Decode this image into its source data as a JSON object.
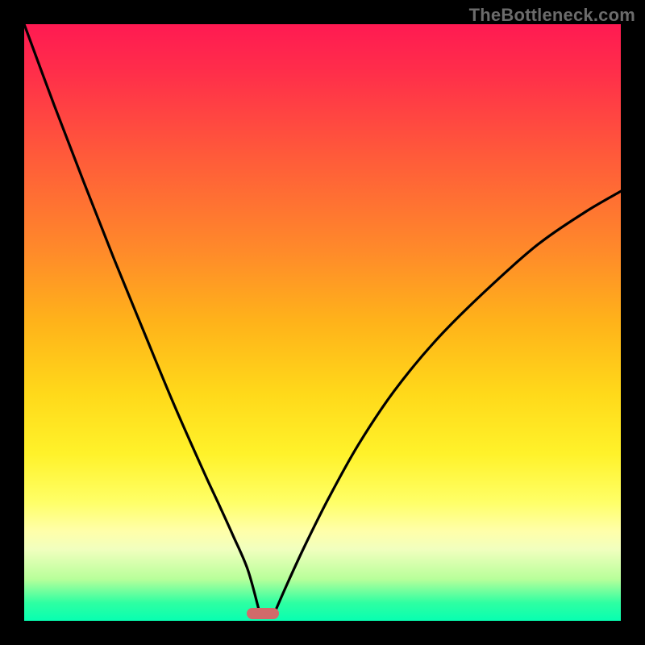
{
  "watermark": "TheBottleneck.com",
  "chart_data": {
    "type": "line",
    "title": "",
    "xlabel": "",
    "ylabel": "",
    "xlim": [
      0,
      1
    ],
    "ylim": [
      0,
      1
    ],
    "background": "rainbow-gradient-red-to-green",
    "marker": {
      "x": 0.4,
      "y": 0.99,
      "shape": "rounded-capsule",
      "color": "#d26a6a"
    },
    "series": [
      {
        "name": "left-curve",
        "x": [
          0.0,
          0.05,
          0.1,
          0.15,
          0.2,
          0.25,
          0.3,
          0.325,
          0.35,
          0.375,
          0.395
        ],
        "y": [
          1.0,
          0.865,
          0.735,
          0.608,
          0.486,
          0.365,
          0.252,
          0.198,
          0.143,
          0.085,
          0.012
        ]
      },
      {
        "name": "right-curve",
        "x": [
          0.419,
          0.44,
          0.47,
          0.51,
          0.56,
          0.62,
          0.69,
          0.77,
          0.86,
          0.94,
          1.0
        ],
        "y": [
          0.012,
          0.06,
          0.125,
          0.205,
          0.295,
          0.385,
          0.47,
          0.55,
          0.63,
          0.685,
          0.72
        ]
      }
    ]
  },
  "colors": {
    "frame": "#000000",
    "curve": "#000000",
    "watermark": "#6b6b6b"
  }
}
